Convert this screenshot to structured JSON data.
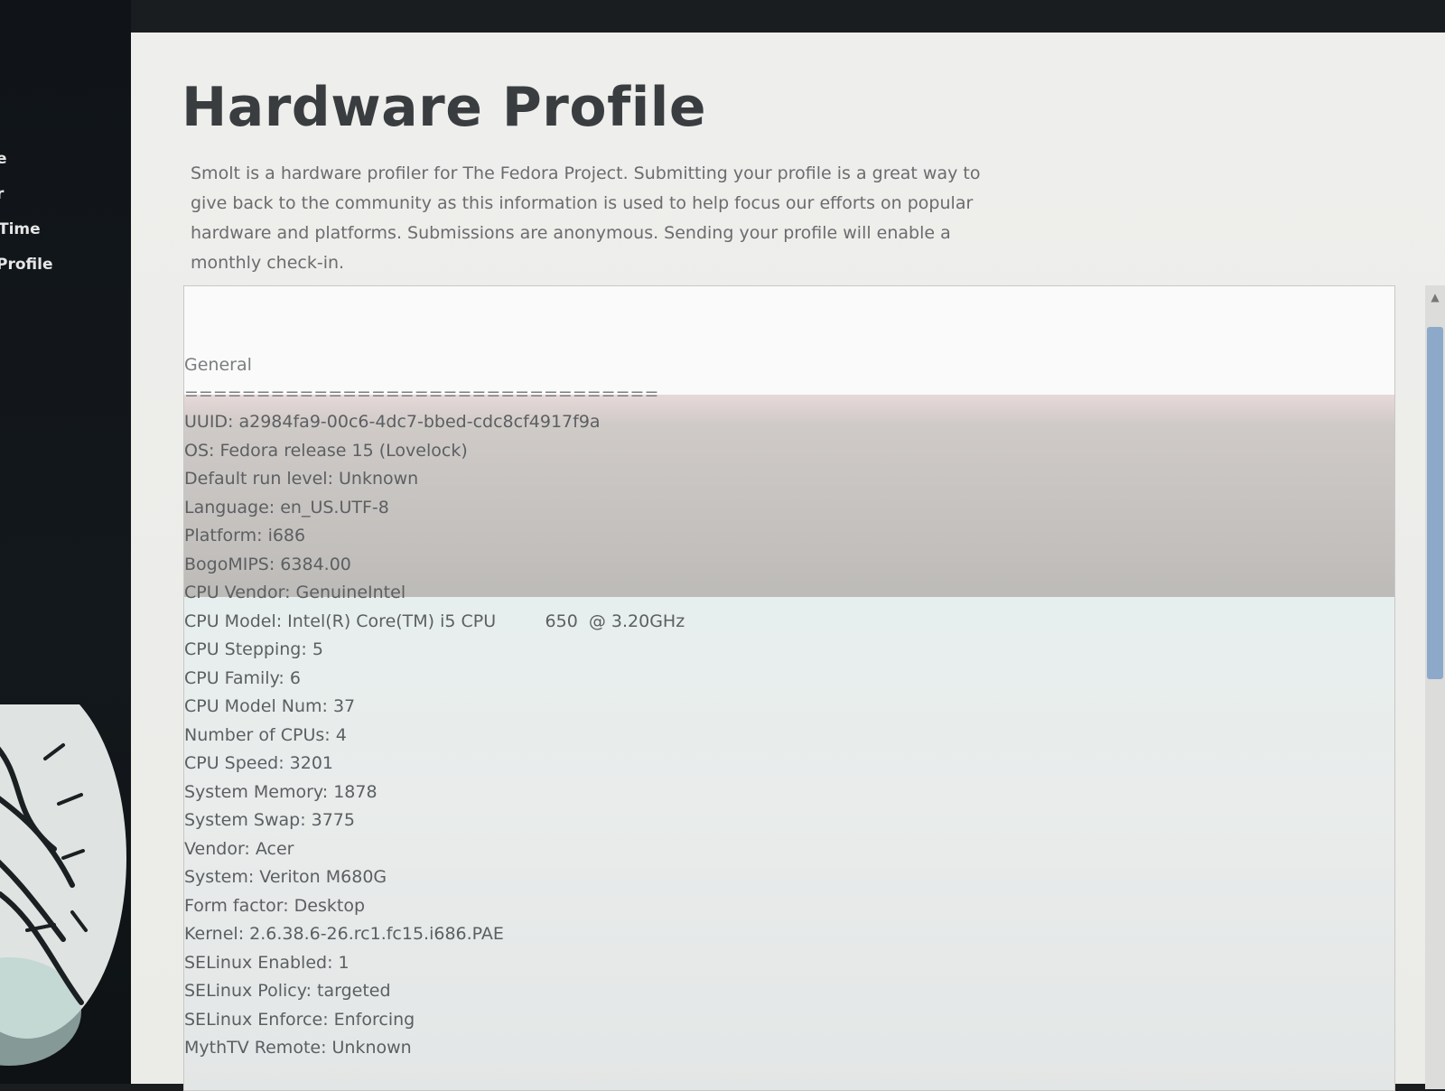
{
  "sidebar": {
    "steps": [
      "e",
      "r",
      "Time",
      "Profile"
    ]
  },
  "main": {
    "title": "Hardware Profile",
    "intro": "Smolt is a hardware profiler for The Fedora Project. Submitting your profile is a great way to give back to the community as this information is used to help focus our efforts on popular hardware and platforms. Submissions are anonymous. Sending your profile will enable a monthly check-in."
  },
  "report": {
    "section": "General",
    "divider": "=================================",
    "lines": [
      "UUID: a2984fa9-00c6-4dc7-bbed-cdc8cf4917f9a",
      "OS: Fedora release 15 (Lovelock)",
      "Default run level: Unknown",
      "Language: en_US.UTF-8",
      "Platform: i686",
      "BogoMIPS: 6384.00",
      "CPU Vendor: GenuineIntel",
      "CPU Model: Intel(R) Core(TM) i5 CPU         650  @ 3.20GHz",
      "CPU Stepping: 5",
      "CPU Family: 6",
      "CPU Model Num: 37",
      "Number of CPUs: 4",
      "CPU Speed: 3201",
      "System Memory: 1878",
      "System Swap: 3775",
      "Vendor: Acer",
      "System: Veriton M680G",
      "Form factor: Desktop",
      "Kernel: 2.6.38.6-26.rc1.fc15.i686.PAE",
      "SELinux Enabled: 1",
      "SELinux Policy: targeted",
      "SELinux Enforce: Enforcing",
      "MythTV Remote: Unknown"
    ]
  }
}
